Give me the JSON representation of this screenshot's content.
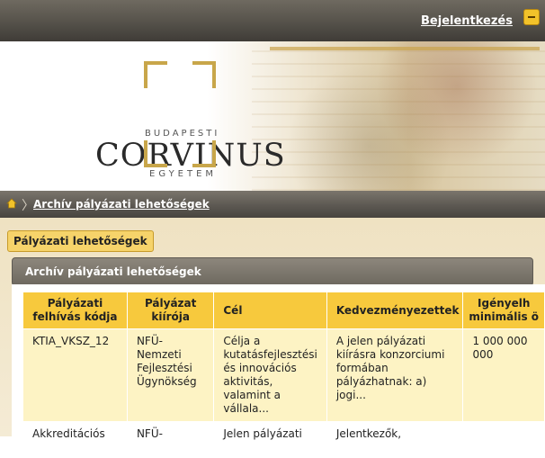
{
  "topbar": {
    "login_label": "Bejelentkezés"
  },
  "logo": {
    "top": "BUDAPESTI",
    "main": "CORVINUS",
    "bottom": "EGYETEM"
  },
  "breadcrumb": {
    "current": "Archív pályázati lehetőségek"
  },
  "tab": {
    "label": "Pályázati lehetőségek"
  },
  "panel": {
    "title": "Archív pályázati lehetőségek"
  },
  "table": {
    "headers": [
      "Pályázati felhívás kódja",
      "Pályázat kiírója",
      "Cél",
      "Kedvezményezettek",
      "Igényelh minimális ö"
    ],
    "rows": [
      [
        "KTIA_VKSZ_12",
        "NFÜ-Nemzeti Fejlesztési Ügynökség",
        "Célja a kutatásfejlesztési és innovációs aktivitás, valamint a vállala...",
        "A jelen pályázati kiírásra konzorciumi formában pályázhatnak: a) jogi...",
        "1 000 000 000"
      ],
      [
        "Akkreditációs",
        "NFÜ-",
        "Jelen pályázati",
        "Jelentkezők,",
        ""
      ]
    ]
  }
}
